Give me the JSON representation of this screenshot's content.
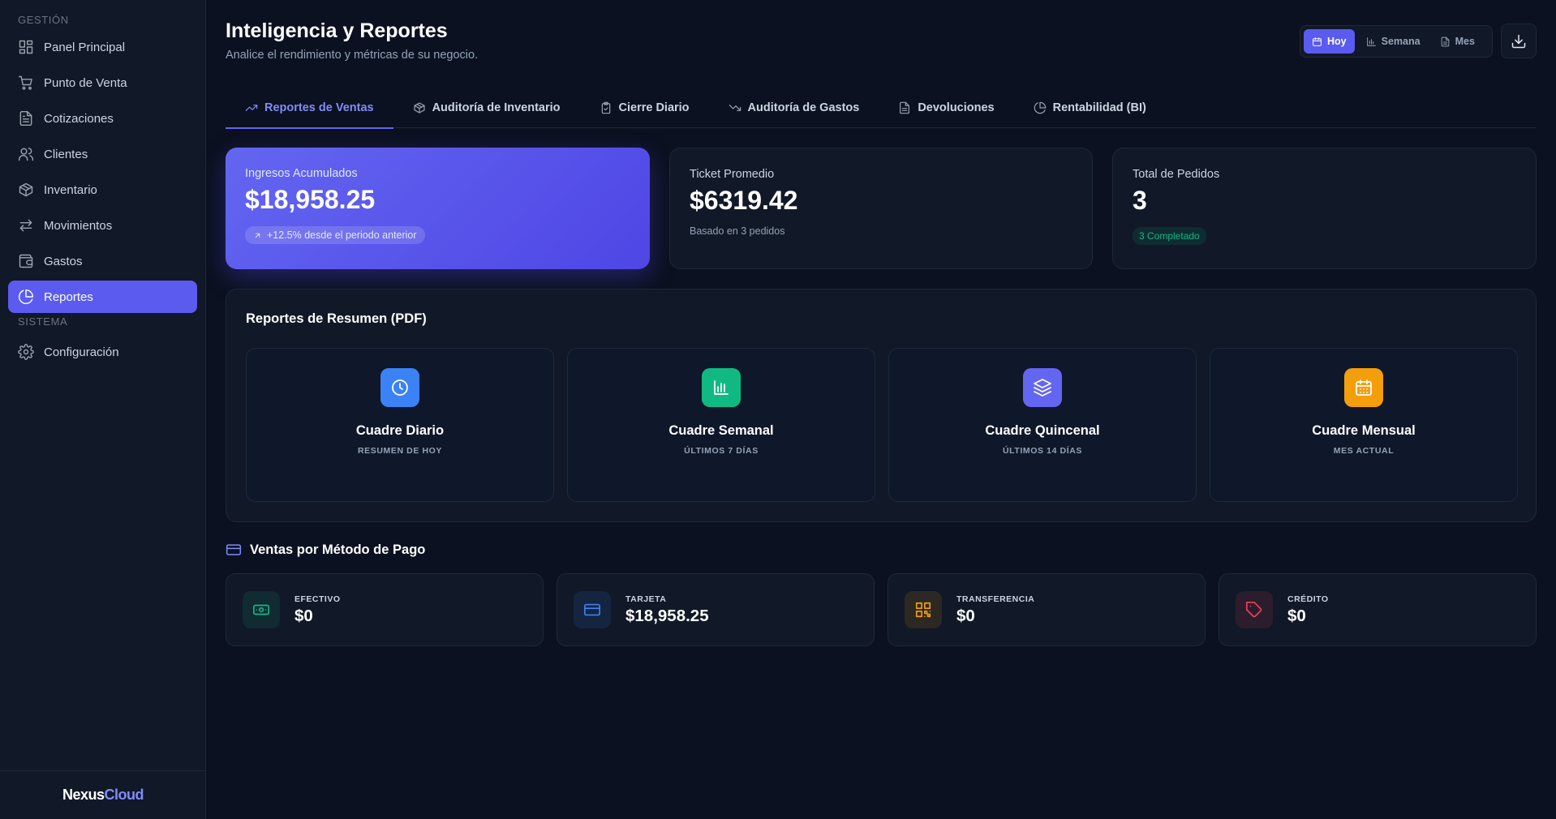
{
  "sidebar": {
    "section_gestion": "GESTIÓN",
    "section_sistema": "SISTEMA",
    "items": [
      {
        "label": "Panel Principal",
        "icon": "dashboard-icon"
      },
      {
        "label": "Punto de Venta",
        "icon": "cart-icon"
      },
      {
        "label": "Cotizaciones",
        "icon": "document-icon"
      },
      {
        "label": "Clientes",
        "icon": "users-icon"
      },
      {
        "label": "Inventario",
        "icon": "box-icon"
      },
      {
        "label": "Movimientos",
        "icon": "arrows-icon"
      },
      {
        "label": "Gastos",
        "icon": "wallet-icon"
      },
      {
        "label": "Reportes",
        "icon": "pie-chart-icon",
        "active": true
      }
    ],
    "settings": {
      "label": "Configuración",
      "icon": "gear-icon"
    },
    "brand_a": "Nexus",
    "brand_b": "Cloud"
  },
  "header": {
    "title": "Inteligencia y Reportes",
    "subtitle": "Analice el rendimiento y métricas de su negocio.",
    "range": {
      "hoy": "Hoy",
      "semana": "Semana",
      "mes": "Mes",
      "selected": "Hoy"
    }
  },
  "tabs": [
    {
      "label": "Reportes de Ventas",
      "active": true
    },
    {
      "label": "Auditoría de Inventario"
    },
    {
      "label": "Cierre Diario"
    },
    {
      "label": "Auditoría de Gastos"
    },
    {
      "label": "Devoluciones"
    },
    {
      "label": "Rentabilidad (BI)"
    }
  ],
  "kpis": {
    "revenue": {
      "label": "Ingresos Acumulados",
      "value": "$18,958.25",
      "trend": "+12.5% desde el periodo anterior"
    },
    "ticket": {
      "label": "Ticket Promedio",
      "value": "$6319.42",
      "note": "Basado en 3 pedidos"
    },
    "orders": {
      "label": "Total de Pedidos",
      "value": "3",
      "badge": "3 Completado"
    }
  },
  "pdf": {
    "title": "Reportes de Resumen (PDF)",
    "cards": [
      {
        "name": "Cuadre Diario",
        "sub": "RESUMEN DE HOY",
        "color": "#3b82f6",
        "icon": "clock-icon"
      },
      {
        "name": "Cuadre Semanal",
        "sub": "ÚLTIMOS 7 DÍAS",
        "color": "#10b981",
        "icon": "bar-chart-icon"
      },
      {
        "name": "Cuadre Quincenal",
        "sub": "ÚLTIMOS 14 DÍAS",
        "color": "#6366f1",
        "icon": "layers-icon"
      },
      {
        "name": "Cuadre Mensual",
        "sub": "MES ACTUAL",
        "color": "#f59e0b",
        "icon": "calendar-icon"
      }
    ]
  },
  "payments": {
    "title": "Ventas por Método de Pago",
    "items": [
      {
        "label": "EFECTIVO",
        "value": "$0",
        "color": "#10b981",
        "icon": "cash-icon"
      },
      {
        "label": "TARJETA",
        "value": "$18,958.25",
        "color": "#3b82f6",
        "icon": "card-icon"
      },
      {
        "label": "TRANSFERENCIA",
        "value": "$0",
        "color": "#f59e0b",
        "icon": "qr-icon"
      },
      {
        "label": "CRÉDITO",
        "value": "$0",
        "color": "#f43f5e",
        "icon": "tag-icon"
      }
    ]
  }
}
